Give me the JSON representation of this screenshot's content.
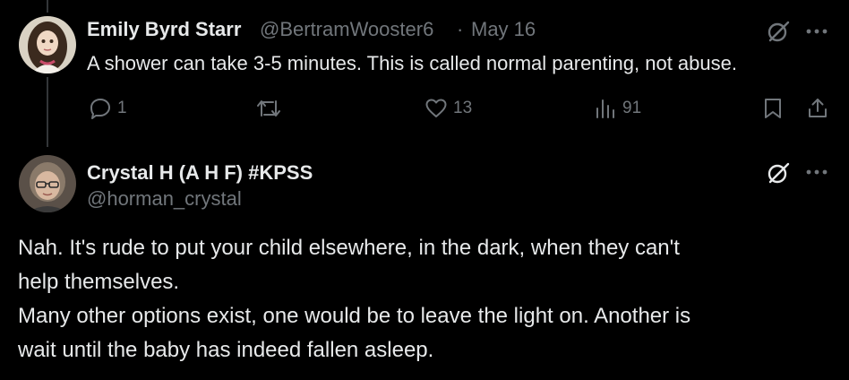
{
  "tweet1": {
    "name": "Emily Byrd Starr",
    "handle": "@BertramWooster6",
    "separator": "·",
    "date": "May 16",
    "text": "A shower can take 3-5 minutes. This is called normal parenting, not abuse.",
    "actions": {
      "replies": "1",
      "retweets": "",
      "likes": "13",
      "views": "91"
    }
  },
  "tweet2": {
    "name": "Crystal H (A H F) #KPSS",
    "handle": "@horman_crystal",
    "body_lines": [
      "Nah. It's rude to put your child elsewhere, in the dark, when they can't",
      "help themselves.",
      "Many other options exist, one would be to leave the light on. Another is",
      "wait until the baby has indeed fallen asleep."
    ]
  },
  "colors": {
    "background": "#000000",
    "primary_text": "#e7e9ea",
    "secondary_text": "#71767b",
    "thread_line": "#333639"
  },
  "icons": [
    "grok-icon",
    "more-icon",
    "reply-icon",
    "retweet-icon",
    "like-icon",
    "views-icon",
    "bookmark-icon",
    "share-icon"
  ]
}
